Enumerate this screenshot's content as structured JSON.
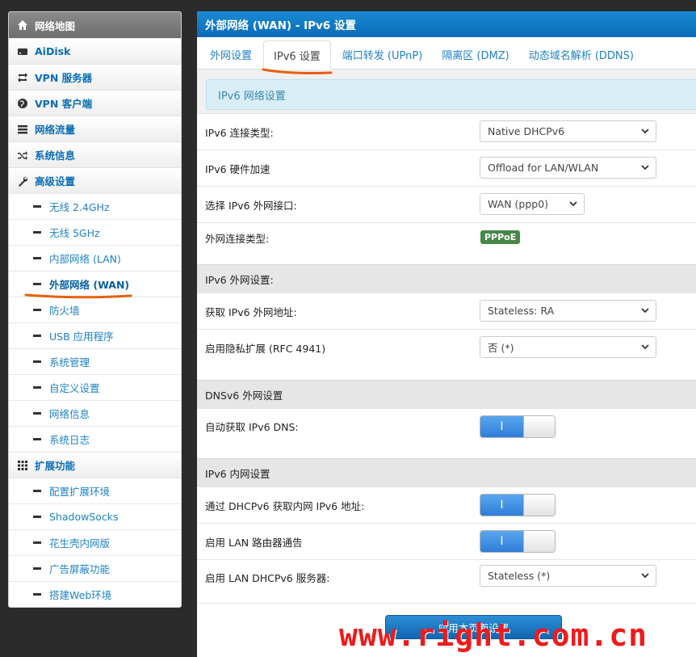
{
  "sidebar": {
    "items": [
      {
        "label": "网络地图",
        "icon": "home-icon",
        "active": true
      },
      {
        "label": "AiDisk",
        "icon": "hdd-icon"
      },
      {
        "label": "VPN 服务器",
        "icon": "retweet-icon"
      },
      {
        "label": "VPN 客户端",
        "icon": "globe-icon"
      },
      {
        "label": "网络流量",
        "icon": "list-icon"
      },
      {
        "label": "系统信息",
        "icon": "random-icon"
      },
      {
        "label": "高级设置",
        "icon": "wrench-icon"
      }
    ],
    "advanced_sub": [
      "无线 2.4GHz",
      "无线 5GHz",
      "内部网络 (LAN)",
      "外部网络 (WAN)",
      "防火墙",
      "USB 应用程序",
      "系统管理",
      "自定义设置",
      "网络信息",
      "系统日志"
    ],
    "extensions_label": "扩展功能",
    "extensions_icon": "grid-icon",
    "extensions_sub": [
      "配置扩展环境",
      "ShadowSocks",
      "花生壳内网版",
      "广告屏蔽功能",
      "搭建Web环境"
    ]
  },
  "main": {
    "title": "外部网络 (WAN) - IPv6 设置",
    "tabs": [
      "外网设置",
      "IPv6 设置",
      "端口转发 (UPnP)",
      "隔离区 (DMZ)",
      "动态域名解析 (DDNS)"
    ],
    "active_tab": "IPv6 设置",
    "info_text": "IPv6 网络设置",
    "fields": {
      "conn_type": {
        "label": "IPv6 连接类型:",
        "value": "Native DHCPv6"
      },
      "hw_accel": {
        "label": "IPv6 硬件加速",
        "value": "Offload for LAN/WLAN"
      },
      "wan_iface": {
        "label": "选择 IPv6 外网接口:",
        "value": "WAN (ppp0)"
      },
      "wan_type": {
        "label": "外网连接类型:",
        "value": "PPPoE"
      }
    },
    "sections": {
      "wan": "IPv6 外网设置:",
      "dns": "DNSv6 外网设置",
      "lan": "IPv6 内网设置"
    },
    "wan_fields": {
      "addr": {
        "label": "获取 IPv6 外网地址:",
        "value": "Stateless: RA"
      },
      "privacy": {
        "label": "启用隐私扩展 (RFC 4941)",
        "value": "否 (*)"
      }
    },
    "dns_fields": {
      "auto_dns": {
        "label": "自动获取 IPv6 DNS:",
        "toggle_text": "I",
        "enabled": true
      }
    },
    "lan_fields": {
      "dhcp_lan": {
        "label": "通过 DHCPv6 获取内网 IPv6 地址:",
        "toggle_text": "I",
        "enabled": true
      },
      "ra": {
        "label": "启用 LAN 路由器通告",
        "toggle_text": "I",
        "enabled": true
      },
      "dhcp_server": {
        "label": "启用 LAN DHCPv6 服务器:",
        "value": "Stateless (*)"
      }
    },
    "apply_label": "应用本页面设置"
  },
  "watermark": "www.right.com.cn",
  "colors": {
    "header_blue": "#0a6bb8",
    "link_blue": "#1f82c4",
    "annotation_orange": "#e8600c",
    "watermark_red": "#ef1a1a",
    "badge_green": "#468847"
  }
}
